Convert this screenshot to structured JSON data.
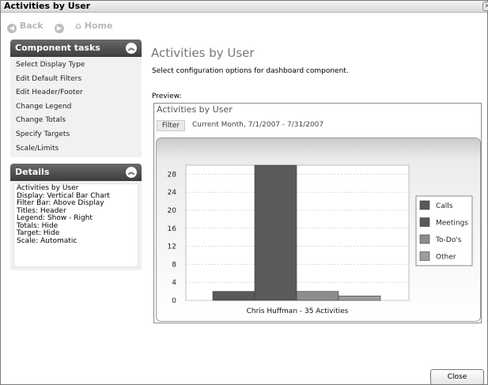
{
  "window": {
    "title": "Activities by User"
  },
  "nav": {
    "back": "Back",
    "home": "Home"
  },
  "sidebar": {
    "tasks_title": "Component tasks",
    "tasks": [
      "Select Display Type",
      "Edit Default Filters",
      "Edit Header/Footer",
      "Change Legend",
      "Change Totals",
      "Specify Targets",
      "Scale/Limits"
    ],
    "details_title": "Details",
    "details": [
      "Activities by User",
      "Display: Vertical Bar Chart",
      "Filter Bar: Above Display",
      "Titles: Header",
      "Legend: Show - Right",
      "Totals: Hide",
      "Target: Hide",
      "Scale: Automatic"
    ]
  },
  "main": {
    "title": "Activities by User",
    "subtitle": "Select configuration options for dashboard component.",
    "preview_label": "Preview:",
    "preview_title": "Activities by User",
    "filter_label": "Filter",
    "filter_text": "Current Month, 7/1/2007 - 7/31/2007"
  },
  "chart_data": {
    "type": "bar",
    "categories": [
      "Chris Huffman - 35 Activities"
    ],
    "series": [
      {
        "name": "Calls",
        "values": [
          2
        ],
        "color": "#595959"
      },
      {
        "name": "Meetings",
        "values": [
          30
        ],
        "color": "#5a5a5a"
      },
      {
        "name": "To-Do's",
        "values": [
          2
        ],
        "color": "#8c8c8c"
      },
      {
        "name": "Other",
        "values": [
          1
        ],
        "color": "#9c9c9c"
      }
    ],
    "y_ticks": [
      "0",
      "4",
      "8",
      "12",
      "16",
      "20",
      "24",
      "28"
    ],
    "ylim": [
      0,
      30
    ],
    "grid": true,
    "legend": "right"
  },
  "buttons": {
    "close": "Close"
  }
}
